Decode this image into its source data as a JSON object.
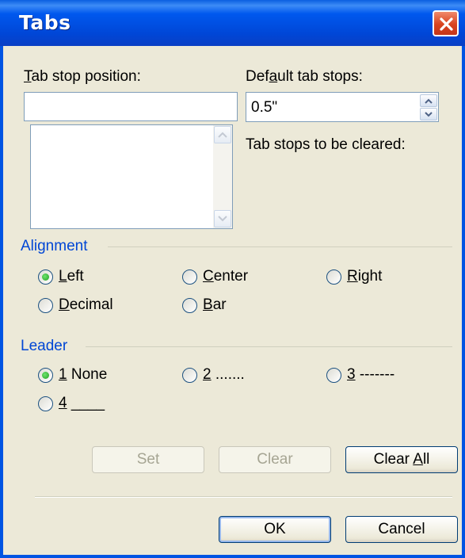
{
  "window": {
    "title": "Tabs"
  },
  "labels": {
    "tab_stop_position_mnemonic": "T",
    "tab_stop_position_rest": "ab stop position:",
    "default_tab_stops_pre": "Def",
    "default_tab_stops_mnemonic": "a",
    "default_tab_stops_rest": "ult tab stops:",
    "tab_stops_cleared": "Tab stops to be cleared:"
  },
  "fields": {
    "tab_stop_position_value": "",
    "default_tab_stops_value": "0.5\""
  },
  "alignment": {
    "title": "Alignment",
    "options": [
      {
        "mnemonic": "L",
        "rest": "eft",
        "checked": true
      },
      {
        "mnemonic": "C",
        "rest": "enter",
        "checked": false
      },
      {
        "mnemonic": "R",
        "rest": "ight",
        "checked": false
      },
      {
        "mnemonic": "D",
        "rest": "ecimal",
        "checked": false
      },
      {
        "mnemonic": "B",
        "rest": "ar",
        "checked": false
      }
    ]
  },
  "leader": {
    "title": "Leader",
    "options": [
      {
        "mnemonic": "1",
        "rest": " None",
        "checked": true
      },
      {
        "mnemonic": "2",
        "rest": " .......",
        "checked": false
      },
      {
        "mnemonic": "3",
        "rest": " -------",
        "checked": false
      },
      {
        "mnemonic": "4",
        "rest": " ____",
        "checked": false
      }
    ]
  },
  "buttons": {
    "set": "Set",
    "clear": "Clear",
    "clear_all_pre": "Clear ",
    "clear_all_mnemonic": "A",
    "clear_all_rest": "ll",
    "ok": "OK",
    "cancel": "Cancel"
  },
  "icons": {
    "close": "close-x-icon",
    "scroll_up": "scroll-up-arrow-icon",
    "scroll_down": "scroll-down-arrow-icon",
    "spin_up": "spin-up-icon",
    "spin_down": "spin-down-icon"
  },
  "colors": {
    "titlebar": "#0054e3",
    "group_title": "#0046d5",
    "dialog_bg": "#ece9d8"
  }
}
